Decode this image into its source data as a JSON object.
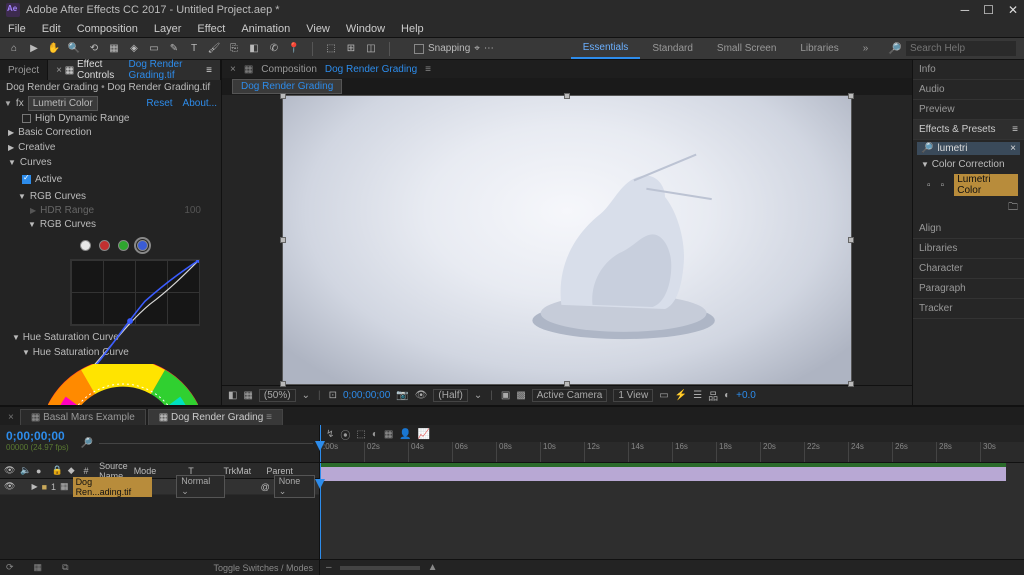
{
  "title": "Adobe After Effects CC 2017 - Untitled Project.aep *",
  "menus": [
    "File",
    "Edit",
    "Composition",
    "Layer",
    "Effect",
    "Animation",
    "View",
    "Window",
    "Help"
  ],
  "snapping_label": "Snapping",
  "workspace_tabs": {
    "active": "Essentials",
    "items": [
      "Essentials",
      "Standard",
      "Small Screen",
      "Libraries"
    ],
    "overflow": "»"
  },
  "search_placeholder": "Search Help",
  "left": {
    "tab_project": "Project",
    "tab_effect_controls": "Effect Controls",
    "tab_ec_link": "Dog Render Grading.tif",
    "breadcrumb_a": "Dog Render Grading",
    "breadcrumb_b": "Dog Render Grading.tif",
    "fx_name": "Lumetri Color",
    "fx_reset": "Reset",
    "fx_about": "About...",
    "hdr_label": "High Dynamic Range",
    "sections": {
      "basic": "Basic Correction",
      "creative": "Creative",
      "curves": "Curves"
    },
    "active_label": "Active",
    "rgb_curves": "RGB Curves",
    "hdr_range": "HDR Range",
    "hdr_range_val": "100",
    "rgb_curves2": "RGB Curves",
    "hue_sat_curve": "Hue Saturation Curve",
    "hue_sat_curve2": "Hue Saturation Curve"
  },
  "comp": {
    "prefix": "Composition",
    "name": "Dog Render Grading",
    "subtab": "Dog Render Grading"
  },
  "viewer": {
    "zoom": "(50%)",
    "time": "0;00;00;00",
    "res": "(Half)",
    "camera": "Active Camera",
    "view": "1 View",
    "shift": "+0.0"
  },
  "right": {
    "info": "Info",
    "audio": "Audio",
    "preview": "Preview",
    "fx_presets": "Effects & Presets",
    "search_value": "lumetri",
    "folder": "Color Correction",
    "effect_name": "Lumetri Color",
    "align": "Align",
    "libraries": "Libraries",
    "character": "Character",
    "paragraph": "Paragraph",
    "tracker": "Tracker"
  },
  "timeline": {
    "tab1": "Basal Mars Example",
    "tab2": "Dog Render Grading",
    "timecode": "0;00;00;00",
    "timecode_sub": "00000 (24.97 fps)",
    "col_source": "Source Name",
    "col_mode": "Mode",
    "col_trkmat": "TrkMat",
    "col_parent": "Parent",
    "layer_num": "1",
    "layer_name": "Dog Ren...ading.tif",
    "layer_mode": "Normal",
    "layer_parent": "None",
    "footer": "Toggle Switches / Modes",
    "ruler": [
      ":00s",
      "02s",
      "04s",
      "06s",
      "08s",
      "10s",
      "12s",
      "14s",
      "16s",
      "18s",
      "20s",
      "22s",
      "24s",
      "26s",
      "28s",
      "30s"
    ]
  }
}
